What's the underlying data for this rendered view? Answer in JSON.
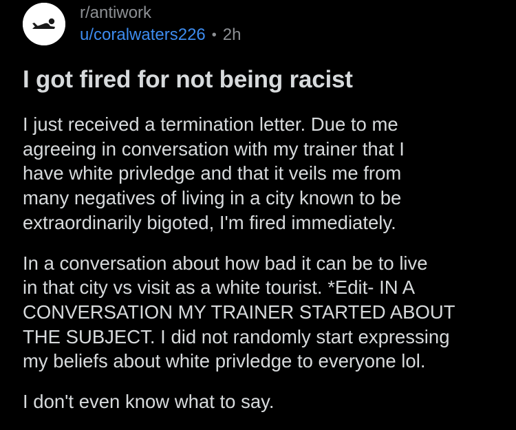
{
  "post": {
    "subreddit": "r/antiwork",
    "username": "u/coralwaters226",
    "separator": "•",
    "age": "2h",
    "title": "I got fired for not being racist",
    "paragraphs": [
      {
        "lines": [
          "I just received a termination letter. Due to me",
          "agreeing in conversation with my trainer that I",
          "have white privledge and that it veils me from",
          "many negatives of living in a city known to be",
          "extraordinarily bigoted, I'm fired immediately."
        ]
      },
      {
        "lines": [
          "In a conversation about how bad it can be to live",
          "in that city vs visit as a white tourist. *Edit- IN A",
          "CONVERSATION MY TRAINER STARTED ABOUT",
          "THE SUBJECT. I did not randomly start expressing",
          "my beliefs about white privledge to everyone lol."
        ]
      },
      {
        "lines": [
          "I don't even know what to say."
        ]
      }
    ]
  },
  "icons": {
    "avatar": "subreddit-avatar-icon"
  },
  "colors": {
    "background": "#000000",
    "text": "#d7dadc",
    "muted": "#8d9094",
    "link": "#3d8cf0"
  }
}
